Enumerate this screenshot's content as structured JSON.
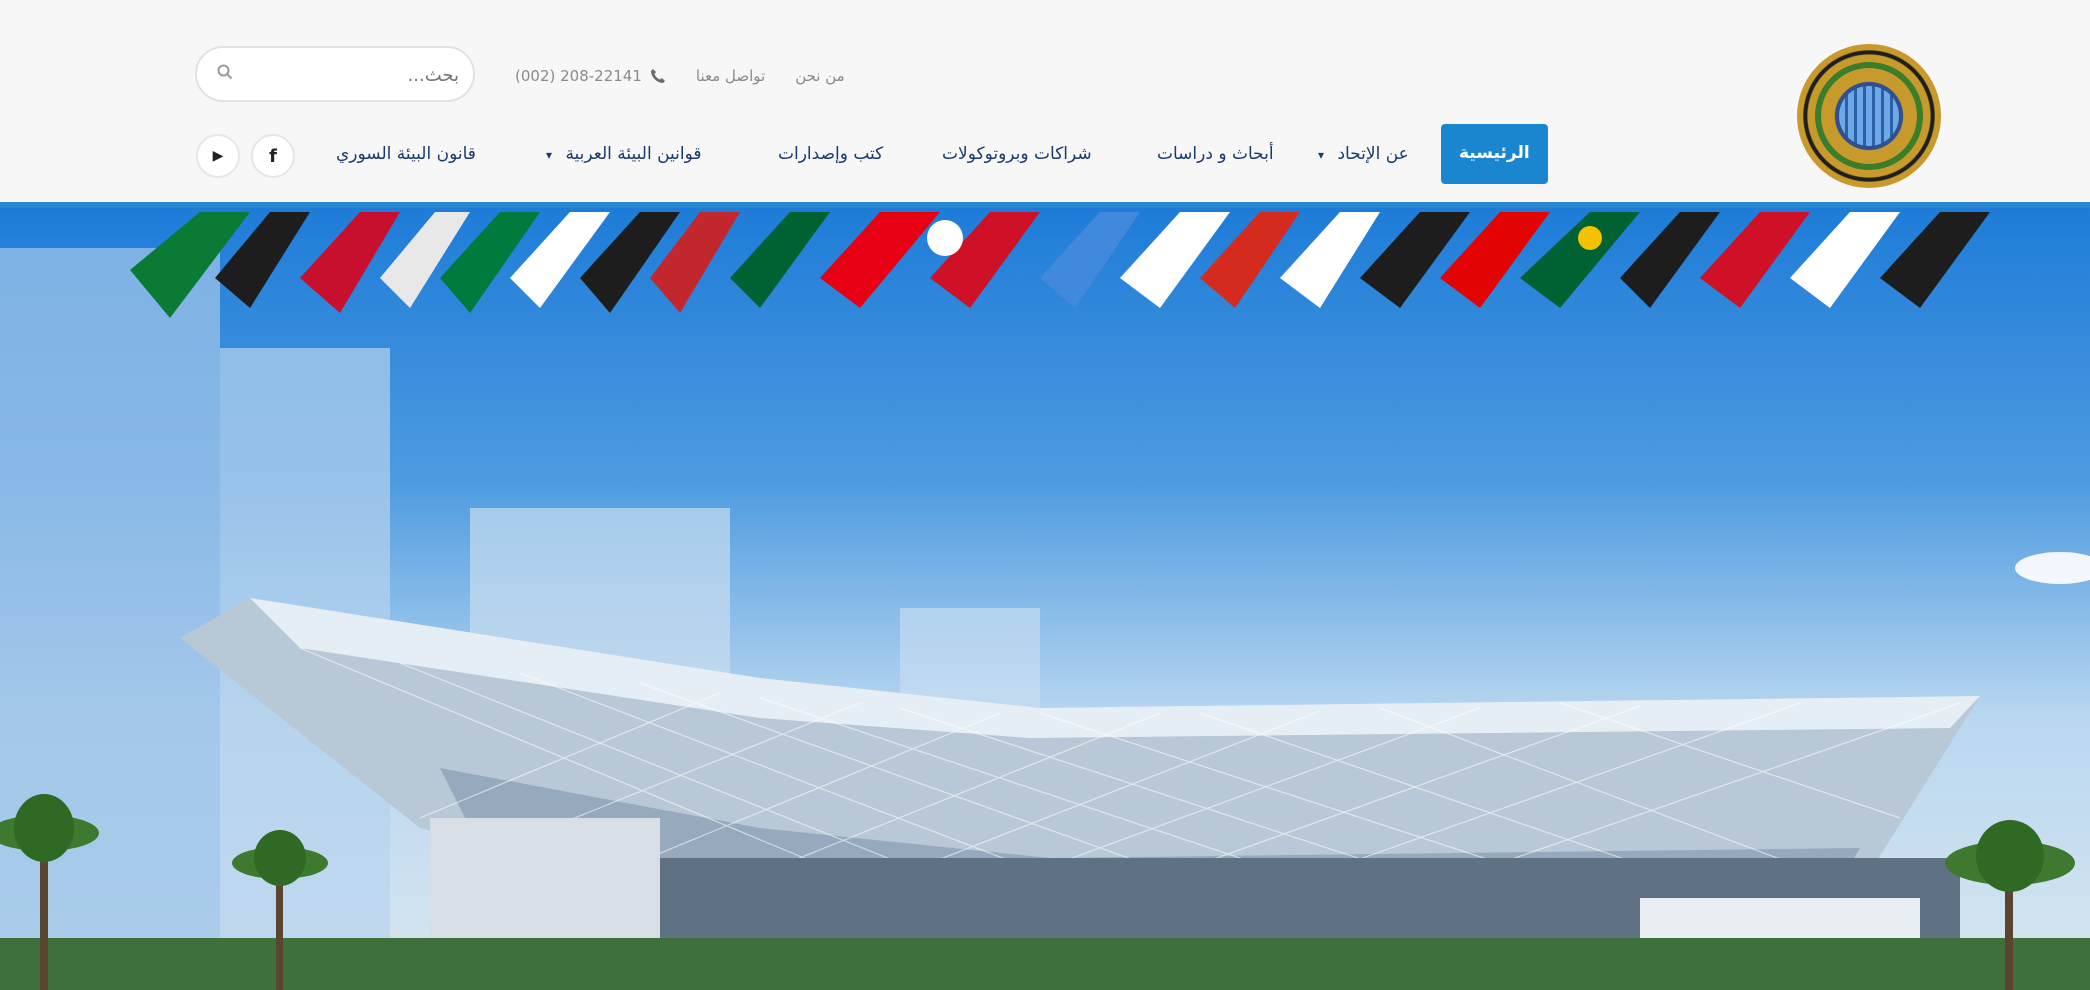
{
  "header": {
    "search": {
      "placeholder": "بحث..."
    },
    "topbar": {
      "about": "من نحن",
      "contact": "تواصل معنا",
      "phone": "(002) 208-22141"
    },
    "nav": {
      "items": [
        {
          "label": "الرئيسية",
          "active": true
        },
        {
          "label": "عن الإتحاد",
          "dropdown": true
        },
        {
          "label": "أبحاث و دراسات"
        },
        {
          "label": "شراكات وبروتوكولات"
        },
        {
          "label": "كتب وإصدارات"
        },
        {
          "label": "قوانين البيئة العربية",
          "dropdown": true
        },
        {
          "label": "قانون البيئة السوري"
        }
      ]
    },
    "social": [
      {
        "icon": "facebook-icon",
        "glyph": "f"
      },
      {
        "icon": "youtube-icon",
        "glyph": "▶"
      }
    ]
  },
  "colors": {
    "accent": "#1a86d0",
    "nav_text": "#1b3a6b",
    "header_bg": "#f7f7f7"
  }
}
